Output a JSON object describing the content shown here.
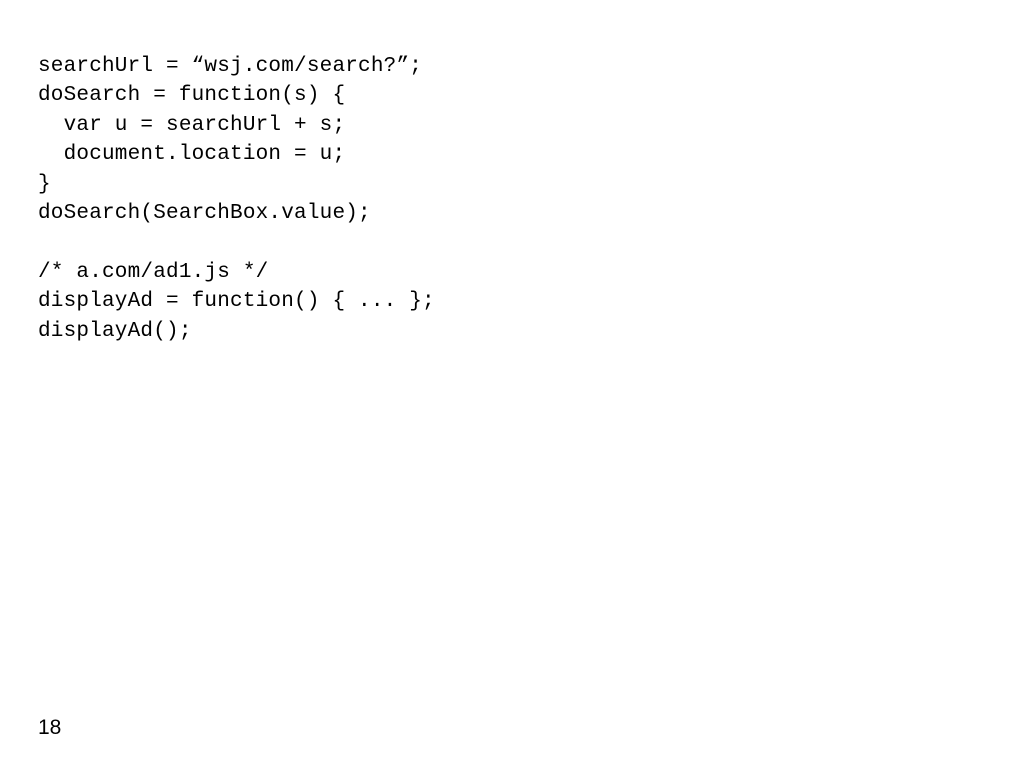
{
  "code": {
    "lines": [
      "searchUrl = “wsj.com/search?”;",
      "doSearch = function(s) {",
      "  var u = searchUrl + s;",
      "  document.location = u;",
      "}",
      "doSearch(SearchBox.value);",
      "",
      "/* a.com/ad1.js */",
      "displayAd = function() { ... };",
      "displayAd();"
    ]
  },
  "page_number": "18"
}
